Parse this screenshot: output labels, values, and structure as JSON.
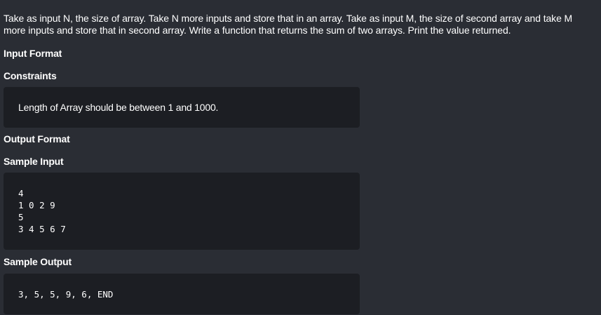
{
  "problem": {
    "description": "Take as input N, the size of array. Take N more inputs and store that in an array. Take as input M, the size of second array and take M more inputs and store that in second array. Write a function that returns the sum of two arrays. Print the value returned.",
    "input_format_heading": "Input Format",
    "constraints_heading": "Constraints",
    "constraints_text": "Length of Array should be between 1 and 1000.",
    "output_format_heading": "Output Format",
    "sample_input_heading": "Sample Input",
    "sample_input_lines": [
      "4",
      "1 0 2 9",
      "5",
      "3 4 5 6 7"
    ],
    "sample_output_heading": "Sample Output",
    "sample_output_text": "3, 5, 5, 9, 6, END"
  },
  "colors": {
    "page_background": "#2a2d34",
    "code_block_background": "#1c1e23",
    "text": "#ffffff"
  }
}
